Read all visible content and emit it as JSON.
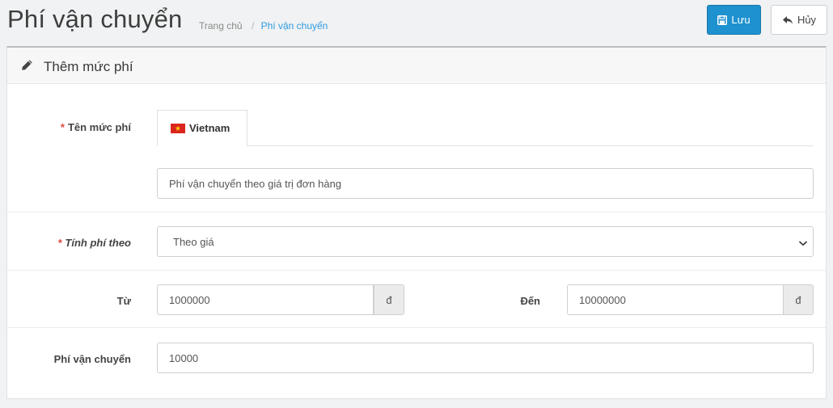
{
  "header": {
    "title": "Phí vận chuyển",
    "breadcrumb": {
      "home": "Trang chủ",
      "separator": "/",
      "current": "Phí vận chuyển"
    },
    "save_label": "Lưu",
    "cancel_label": "Hủy"
  },
  "panel": {
    "title": "Thêm mức phí",
    "icon": "pencil-icon"
  },
  "form": {
    "required_mark": "*",
    "name": {
      "label": "Tên mức phí",
      "tab_label": "Vietnam",
      "tab_icon": "vietnam-flag-icon",
      "value": "Phí vận chuyển theo giá trị đơn hàng"
    },
    "charge_by": {
      "label": "Tính phí theo",
      "value": "Theo giá"
    },
    "range": {
      "from_label": "Từ",
      "from_value": "1000000",
      "to_label": "Đến",
      "to_value": "10000000",
      "currency": "đ"
    },
    "fee": {
      "label": "Phí vận chuyển",
      "value": "10000"
    }
  },
  "colors": {
    "primary": "#1e91cf",
    "required": "#e2453c",
    "link": "#2e9ae0"
  }
}
